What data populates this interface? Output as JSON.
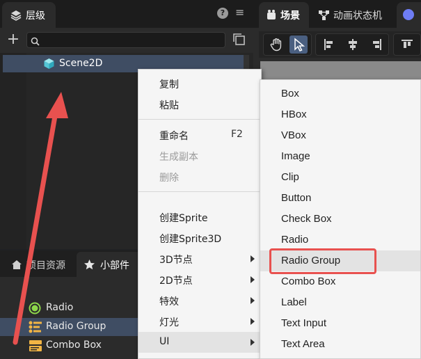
{
  "hierarchy": {
    "tab_label": "层级",
    "help_glyph": "?",
    "menu_glyph": "≡",
    "add_glyph": "+",
    "search_value": "",
    "scene_node": "Scene2D"
  },
  "bottom_panel": {
    "tabs": [
      {
        "label": "项目资源"
      },
      {
        "label": "小部件"
      }
    ],
    "widgets": [
      {
        "label": "Radio",
        "icon": "radio-icon"
      },
      {
        "label": "Radio Group",
        "icon": "radio-group-icon"
      },
      {
        "label": "Combo Box",
        "icon": "combo-box-icon"
      }
    ]
  },
  "scene_panel": {
    "tabs": [
      {
        "label": "场景"
      },
      {
        "label": "动画状态机"
      }
    ]
  },
  "context_menu": {
    "items": [
      {
        "label": "复制"
      },
      {
        "label": "粘贴"
      },
      {
        "label": "重命名",
        "shortcut": "F2"
      },
      {
        "label": "生成副本"
      },
      {
        "label": "删除"
      },
      {
        "label": "创建Sprite"
      },
      {
        "label": "创建Sprite3D"
      },
      {
        "label": "3D节点"
      },
      {
        "label": "2D节点"
      },
      {
        "label": "特效"
      },
      {
        "label": "灯光"
      },
      {
        "label": "UI"
      }
    ]
  },
  "submenu": {
    "items": [
      {
        "label": "Box"
      },
      {
        "label": "HBox"
      },
      {
        "label": "VBox"
      },
      {
        "label": "Image"
      },
      {
        "label": "Clip"
      },
      {
        "label": "Button"
      },
      {
        "label": "Check Box"
      },
      {
        "label": "Radio"
      },
      {
        "label": "Radio Group"
      },
      {
        "label": "Combo Box"
      },
      {
        "label": "Label"
      },
      {
        "label": "Text Input"
      },
      {
        "label": "Text Area"
      }
    ]
  },
  "colors": {
    "accent_blue": "#3f4d63",
    "annotation_red": "#e8514f",
    "menu_bg": "#f5f5f5"
  }
}
